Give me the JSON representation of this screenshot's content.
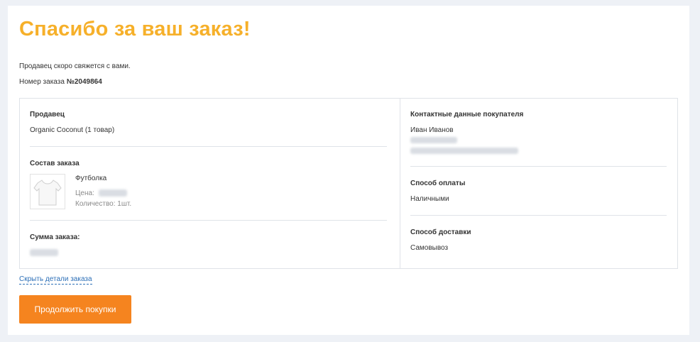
{
  "page": {
    "title": "Спасибо за ваш заказ!",
    "message": "Продавец скоро свяжется с вами.",
    "order_number_label": "Номер заказа",
    "order_number_value": "№2049864"
  },
  "seller": {
    "heading": "Продавец",
    "name": "Organic Coconut (1 товар)"
  },
  "order": {
    "heading": "Состав заказа",
    "item": {
      "name": "Футболка",
      "price_label": "Цена:",
      "quantity_label": "Количество: 1шт."
    },
    "total_heading": "Сумма заказа:",
    "blurred": {
      "icon": "tshirt-icon"
    }
  },
  "buyer": {
    "heading": "Контактные данные покупателя",
    "name": "Иван Иванов"
  },
  "payment": {
    "heading": "Способ оплаты",
    "value": "Наличными"
  },
  "delivery": {
    "heading": "Способ доставки",
    "value": "Самовывоз"
  },
  "actions": {
    "hide_details": "Скрыть детали заказа",
    "continue": "Продолжить покупки"
  },
  "colors": {
    "title": "#f6b02a",
    "button": "#f5841f",
    "link": "#2c6fb7",
    "background": "#eef1f6"
  }
}
